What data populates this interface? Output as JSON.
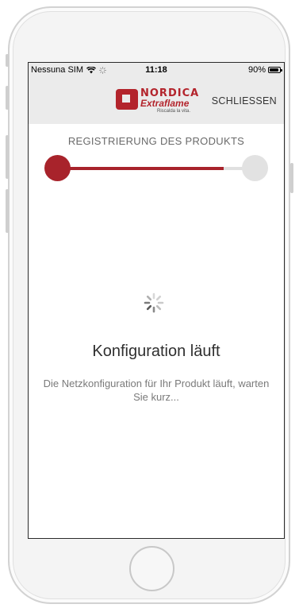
{
  "status_bar": {
    "carrier": "Nessuna SIM",
    "time": "11:18",
    "battery": "90%",
    "battery_level": 0.9
  },
  "header": {
    "logo_brand_top": "NORDICA",
    "logo_brand_mid": "Extraflame",
    "logo_tagline": "Riscalda la vita.",
    "close_label": "SCHLIESSEN"
  },
  "registration": {
    "step_title": "REGISTRIERUNG DES PRODUKTS",
    "progress_fraction": 0.84
  },
  "status": {
    "title": "Konfiguration läuft",
    "description": "Die Netzkonfiguration für Ihr Produkt läuft, warten Sie kurz..."
  },
  "colors": {
    "accent": "#a8232b",
    "header_bg": "#ebebeb",
    "inactive": "#e2e2e2"
  },
  "icons": {
    "wifi": "wifi-icon",
    "battery": "battery-icon",
    "spinner": "loading-spinner-icon",
    "home": "home-button"
  }
}
